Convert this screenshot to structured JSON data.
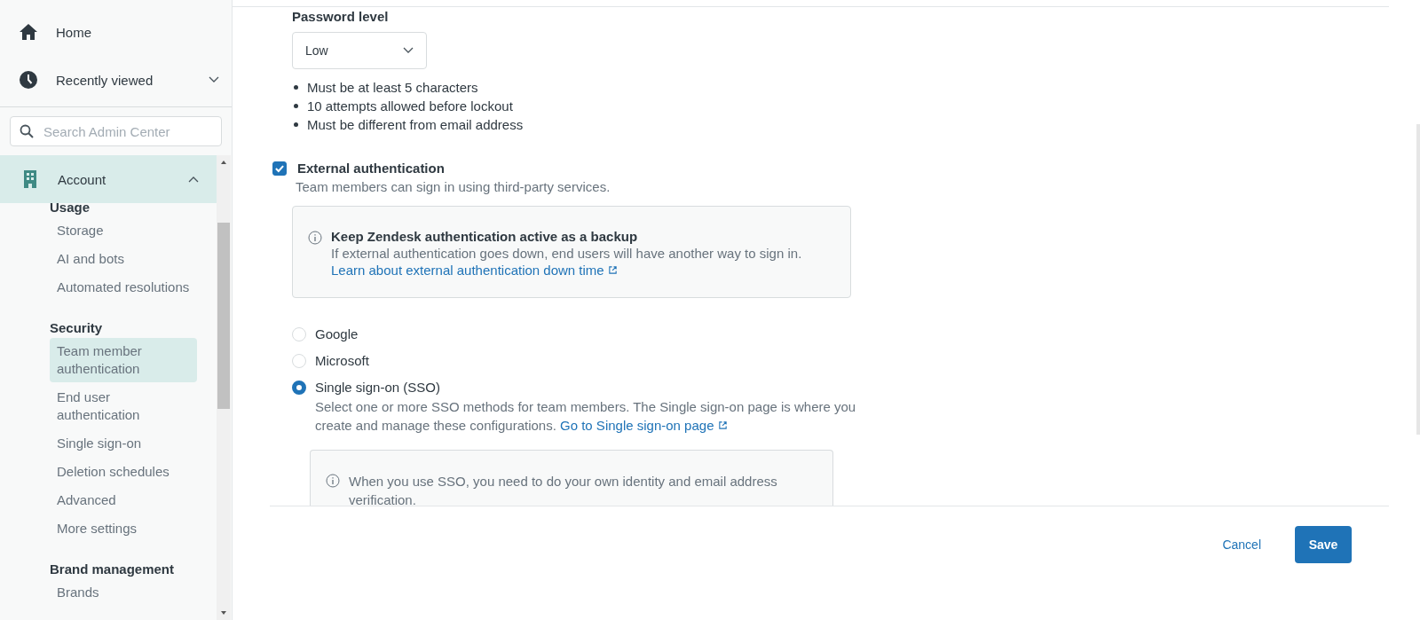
{
  "sidebar": {
    "top_items": [
      {
        "label": "Home"
      },
      {
        "label": "Recently viewed",
        "expanded": false
      }
    ],
    "search": {
      "placeholder": "Search Admin Center"
    },
    "section": {
      "label": "Account",
      "expanded": true,
      "selected": true
    },
    "groups": [
      {
        "heading": "Usage",
        "items": [
          {
            "label": "Storage",
            "selected": false
          },
          {
            "label": "AI and bots",
            "selected": false
          },
          {
            "label": "Automated resolutions",
            "selected": false
          }
        ]
      },
      {
        "heading": "Security",
        "items": [
          {
            "label": "Team member authentication",
            "selected": true
          },
          {
            "label": "End user authentication",
            "selected": false
          },
          {
            "label": "Single sign-on",
            "selected": false
          },
          {
            "label": "Deletion schedules",
            "selected": false
          },
          {
            "label": "Advanced",
            "selected": false
          },
          {
            "label": "More settings",
            "selected": false
          }
        ]
      },
      {
        "heading": "Brand management",
        "items": [
          {
            "label": "Brands",
            "selected": false
          }
        ]
      }
    ]
  },
  "main": {
    "password_level": {
      "label": "Password level",
      "value": "Low"
    },
    "rules": [
      "Must be at least 5 characters",
      "10 attempts allowed before lockout",
      "Must be different from email address"
    ],
    "external_auth": {
      "label": "External authentication",
      "checked": true,
      "description": "Team members can sign in using third-party services."
    },
    "notice": {
      "title": "Keep Zendesk authentication active as a backup",
      "text": "If external authentication goes down, end users will have another way to sign in.",
      "link": "Learn about external authentication down time"
    },
    "methods": [
      {
        "label": "Google",
        "selected": false
      },
      {
        "label": "Microsoft",
        "selected": false
      },
      {
        "label": "Single sign-on (SSO)",
        "selected": true
      }
    ],
    "sso_detail": {
      "text": "Select one or more SSO methods for team members. The Single sign-on page is where you create and manage these configurations.",
      "link": "Go to Single sign-on page"
    },
    "sso_note": "When you use SSO, you need to do your own identity and email address verification."
  },
  "footer": {
    "cancel": "Cancel",
    "save": "Save"
  }
}
